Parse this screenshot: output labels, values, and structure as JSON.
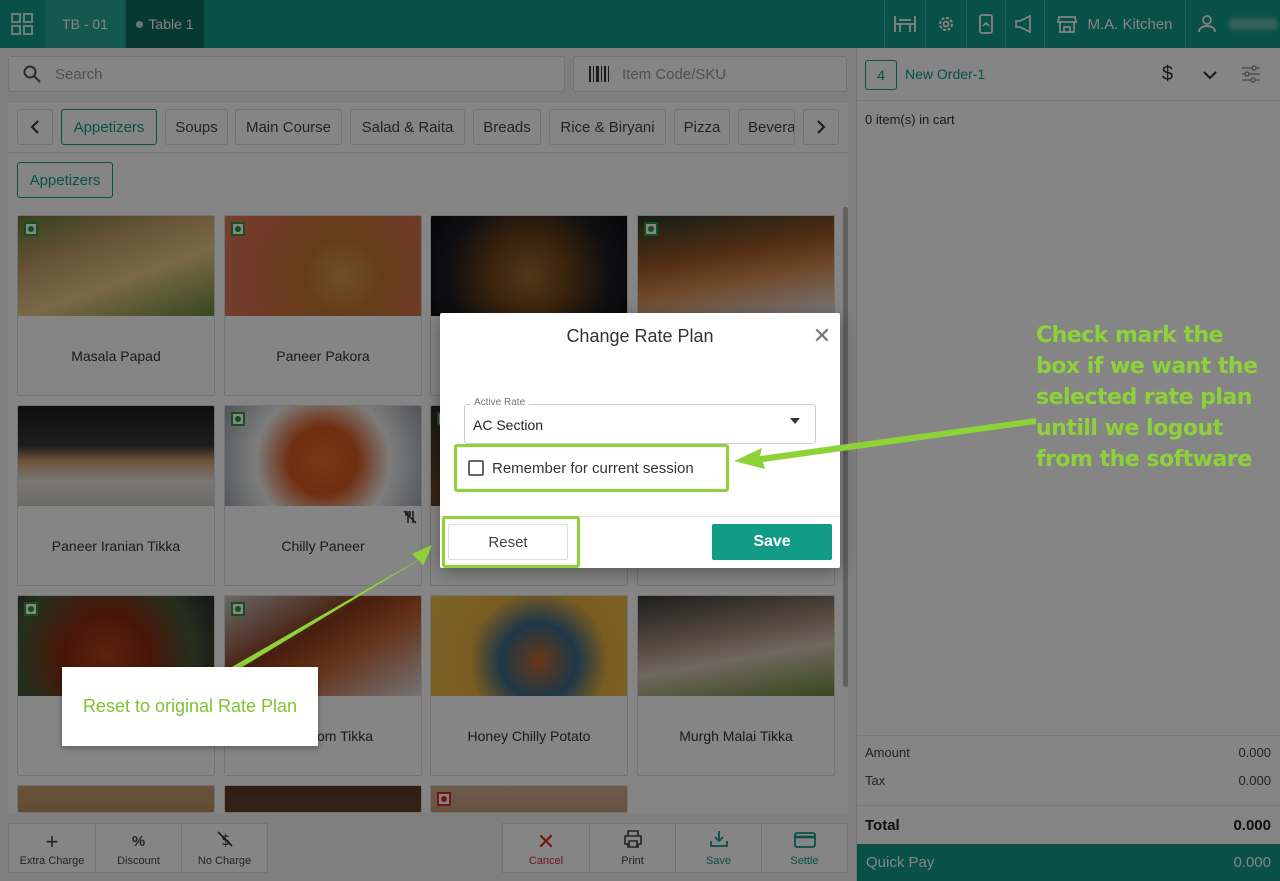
{
  "topbar": {
    "table_code": "TB - 01",
    "table_name": "Table 1",
    "kitchen": "M.A. Kitchen"
  },
  "search": {
    "placeholder": "Search"
  },
  "sku": {
    "placeholder": "Item Code/SKU"
  },
  "categories": [
    "Appetizers",
    "Soups",
    "Main Course",
    "Salad & Raita",
    "Breads",
    "Rice & Biryani",
    "Pizza",
    "Bevera"
  ],
  "subcategory": "Appetizers",
  "items": [
    {
      "name": "Masala Papad",
      "veg": true
    },
    {
      "name": "Paneer Pakora",
      "veg": true
    },
    {
      "name": "",
      "veg": false
    },
    {
      "name": "",
      "veg": true
    },
    {
      "name": "Paneer Iranian Tikka",
      "veg": false
    },
    {
      "name": "Chilly Paneer",
      "veg": true
    },
    {
      "name": "",
      "veg": true
    },
    {
      "name": "",
      "veg": false
    },
    {
      "name": "",
      "veg": true
    },
    {
      "name": "om Tikka",
      "veg": true
    },
    {
      "name": "Honey Chilly Potato",
      "veg": false
    },
    {
      "name": "Murgh Malai Tikka",
      "veg": false
    }
  ],
  "bottom_left": [
    "Extra Charge",
    "Discount",
    "No Charge"
  ],
  "bottom_right": [
    "Cancel",
    "Print",
    "Save",
    "Settle"
  ],
  "order": {
    "number": "4",
    "label": "New Order-1",
    "cart_info": "0 item(s) in cart",
    "amount_label": "Amount",
    "amount": "0.000",
    "tax_label": "Tax",
    "tax": "0.000",
    "total_label": "Total",
    "total": "0.000",
    "quickpay_label": "Quick Pay",
    "quickpay": "0.000"
  },
  "modal": {
    "title": "Change Rate Plan",
    "field_label": "Active Rate",
    "field_value": "AC Section",
    "checkbox_label": "Remember for current session",
    "reset": "Reset",
    "save": "Save"
  },
  "annotations": {
    "right": "Check mark the box if we want the selected rate plan untill  we logout from the software",
    "left": "Reset to original Rate Plan"
  },
  "colors": {
    "accent": "#129b87",
    "highlight": "#8ed23a",
    "cancel": "#d62b2b"
  }
}
